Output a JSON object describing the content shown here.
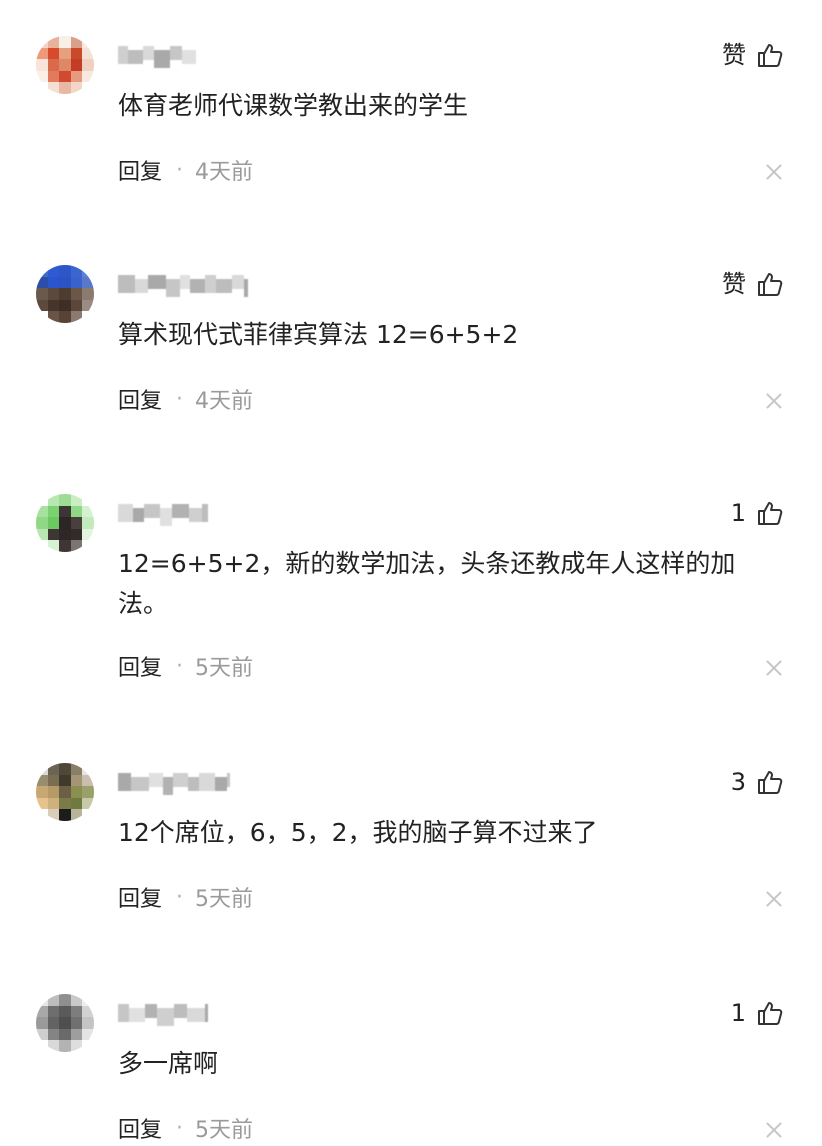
{
  "comments": [
    {
      "like_label": "赞",
      "text": "体育老师代课数学教出来的学生",
      "reply_label": "回复",
      "separator": "·",
      "time": "4天前",
      "avatar_colors": [
        "#f2d7c9",
        "#e7b39a",
        "#f8efe7",
        "#d9a08a",
        "#f6e8dd",
        "#ee9a7a",
        "#d74b2c",
        "#e5a07e",
        "#c94a2a",
        "#f3e1d6",
        "#f8e4d8",
        "#d96a4c",
        "#e08866",
        "#c23d24",
        "#f1d0c0",
        "#fbefe8",
        "#e37a5b",
        "#cf4a2f",
        "#e69b80",
        "#f8e9e0",
        "#ffffff",
        "#f5dfd3",
        "#e9b8a4",
        "#f4d6c8",
        "#ffffff"
      ]
    },
    {
      "like_label": "赞",
      "text": "算术现代式菲律宾算法 12=6+5+2",
      "reply_label": "回复",
      "separator": "·",
      "time": "4天前",
      "avatar_colors": [
        "#3d6cc9",
        "#2f5bd0",
        "#2e56c8",
        "#3b66d2",
        "#5d80d8",
        "#2d4ea8",
        "#2b55cf",
        "#2c52c4",
        "#3a62cc",
        "#5a78c9",
        "#6a5a4e",
        "#5a4a3e",
        "#4e3c30",
        "#6b5648",
        "#8a7a70",
        "#5e4a3c",
        "#46352a",
        "#3e2e24",
        "#5a463a",
        "#9a8c84",
        "#ffffff",
        "#6a5448",
        "#574236",
        "#8c7a70",
        "#ffffff"
      ]
    },
    {
      "like_label": "1",
      "text": "12=6+5+2，新的数学加法，头条还教成年人这样的加法。",
      "reply_label": "回复",
      "separator": "·",
      "time": "5天前",
      "avatar_colors": [
        "#ffffff",
        "#b9e7b2",
        "#9ddc95",
        "#c9eec4",
        "#ffffff",
        "#a6e19e",
        "#7ed173",
        "#3b3533",
        "#8fd885",
        "#d5f1d1",
        "#8fd885",
        "#6cc860",
        "#2c2626",
        "#4a3f3c",
        "#c2eabc",
        "#b7e6b0",
        "#3e3534",
        "#2e2728",
        "#332b2b",
        "#e1f5de",
        "#ffffff",
        "#d8f1d4",
        "#3f3535",
        "#7c7373",
        "#ffffff"
      ]
    },
    {
      "like_label": "3",
      "text": "12个席位，6，5，2，我的脑子算不过来了",
      "reply_label": "回复",
      "separator": "·",
      "time": "5天前",
      "avatar_colors": [
        "#d9d9d9",
        "#6b6354",
        "#4e4838",
        "#8a7e68",
        "#e8e5df",
        "#9a8c6e",
        "#7a6d52",
        "#3f3a2c",
        "#a59574",
        "#c8bfae",
        "#c8a872",
        "#b59a66",
        "#6b6046",
        "#8b8f52",
        "#9aa06a",
        "#e6c38a",
        "#d0b07c",
        "#7b7a4a",
        "#6f7a3e",
        "#c7c8a8",
        "#ffffff",
        "#d8cdb8",
        "#1c1c1c",
        "#b8b49c",
        "#ffffff"
      ]
    },
    {
      "like_label": "1",
      "text": "多一席啊",
      "reply_label": "回复",
      "separator": "·",
      "time": "5天前",
      "avatar_colors": [
        "#e6e6e6",
        "#bdbdbd",
        "#8f8f8f",
        "#c9c9c9",
        "#eeeeee",
        "#a8a8a8",
        "#6e6e6e",
        "#5a5a5a",
        "#7d7d7d",
        "#d2d2d2",
        "#9a9a9a",
        "#636363",
        "#4f4f4f",
        "#707070",
        "#c4c4c4",
        "#cfcfcf",
        "#848484",
        "#6a6a6a",
        "#9e9e9e",
        "#e4e4e4",
        "#ffffff",
        "#d9d9d9",
        "#b3b3b3",
        "#dedede",
        "#ffffff"
      ]
    }
  ]
}
